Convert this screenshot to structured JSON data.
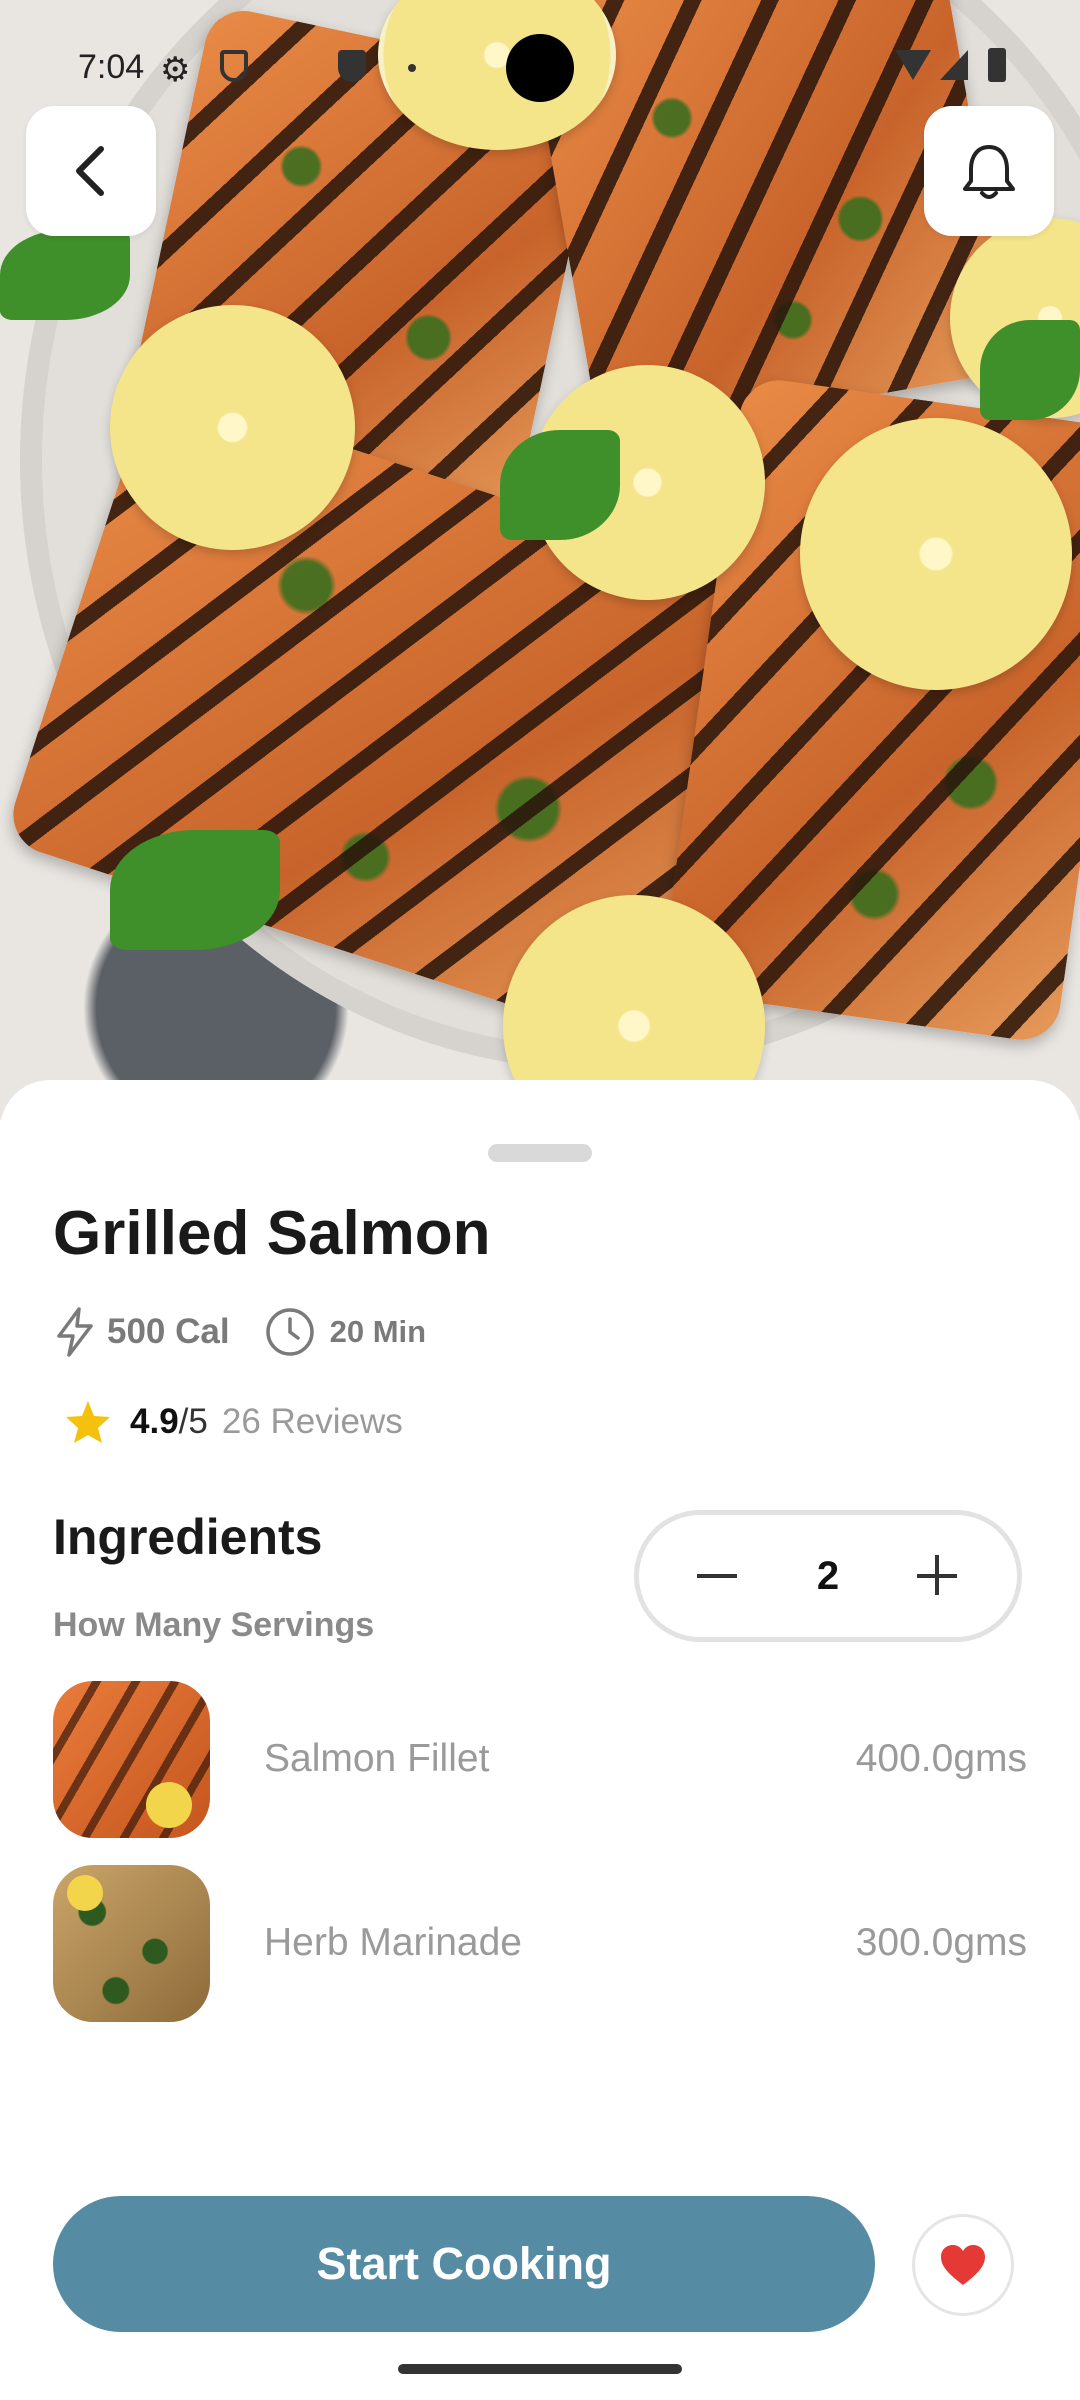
{
  "status_bar": {
    "time": "7:04"
  },
  "header": {
    "back_icon": "chevron-left-icon",
    "bell_icon": "bell-icon"
  },
  "recipe": {
    "title": "Grilled Salmon",
    "calories": "500 Cal",
    "duration": "20 Min",
    "rating": "4.9",
    "rating_scale": "/5",
    "reviews": "26 Reviews"
  },
  "ingredients_section": {
    "title": "Ingredients",
    "servings_label": "How Many Servings",
    "servings": "2",
    "items": [
      {
        "name": "Salmon Fillet",
        "quantity": "400.0gms"
      },
      {
        "name": "Herb Marinade",
        "quantity": "300.0gms"
      }
    ]
  },
  "actions": {
    "start_label": "Start Cooking"
  },
  "colors": {
    "accent": "#558ba3",
    "star": "#f4c20d",
    "heart": "#e53935"
  }
}
